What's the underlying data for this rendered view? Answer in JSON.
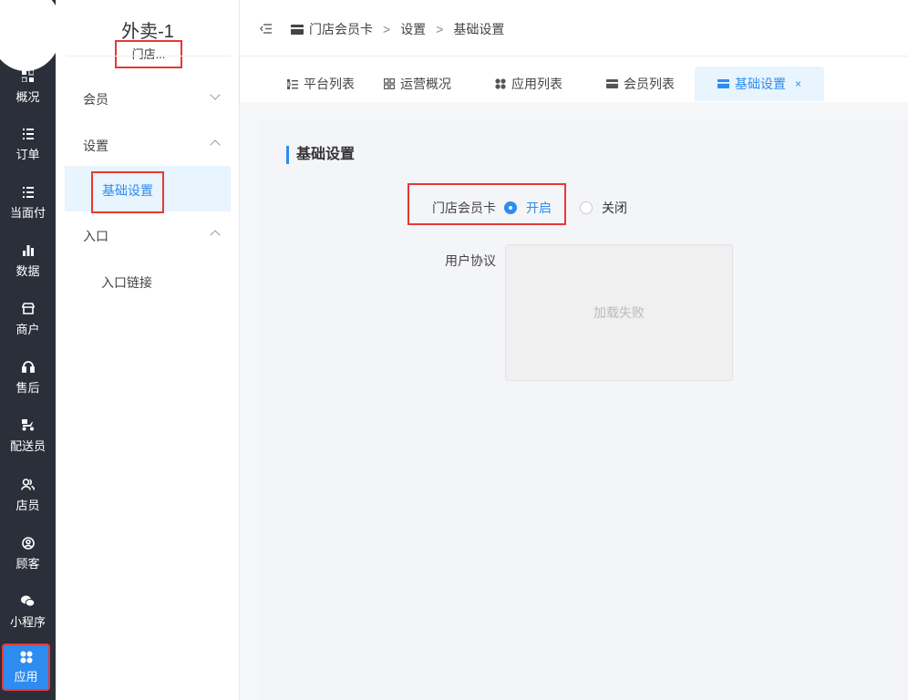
{
  "rail": {
    "items": [
      {
        "label": "概况",
        "icon": "dashboard-icon"
      },
      {
        "label": "订单",
        "icon": "list-icon"
      },
      {
        "label": "当面付",
        "icon": "list-icon"
      },
      {
        "label": "数据",
        "icon": "bar-chart-icon"
      },
      {
        "label": "商户",
        "icon": "shop-icon"
      },
      {
        "label": "售后",
        "icon": "headset-icon"
      },
      {
        "label": "配送员",
        "icon": "scooter-icon"
      },
      {
        "label": "店员",
        "icon": "users-icon"
      },
      {
        "label": "顾客",
        "icon": "user-circle-icon"
      },
      {
        "label": "小程序",
        "icon": "wechat-icon"
      },
      {
        "label": "应用",
        "icon": "apps-icon"
      }
    ]
  },
  "menu": {
    "store_name": "外卖-1",
    "store_sub": "门店...",
    "groups": [
      {
        "label": "会员"
      },
      {
        "label": "设置"
      },
      {
        "label": "入口"
      }
    ],
    "sub_active": "基础设置",
    "sub_entry": "入口链接"
  },
  "breadcrumb": {
    "items": [
      "门店会员卡",
      "设置",
      "基础设置"
    ],
    "sep": ">"
  },
  "tabs": [
    {
      "label": "平台列表"
    },
    {
      "label": "运营概况"
    },
    {
      "label": "应用列表"
    },
    {
      "label": "会员列表"
    },
    {
      "label": "基础设置",
      "close": "×"
    }
  ],
  "content": {
    "section_title": "基础设置",
    "member_card_label": "门店会员卡",
    "radio_on": "开启",
    "radio_off": "关闭",
    "agreement_label": "用户协议",
    "image_placeholder": "加载失败"
  },
  "colors": {
    "accent": "#2d8cf0",
    "rail_bg": "#2b2f3a",
    "highlight": "#e53935"
  }
}
